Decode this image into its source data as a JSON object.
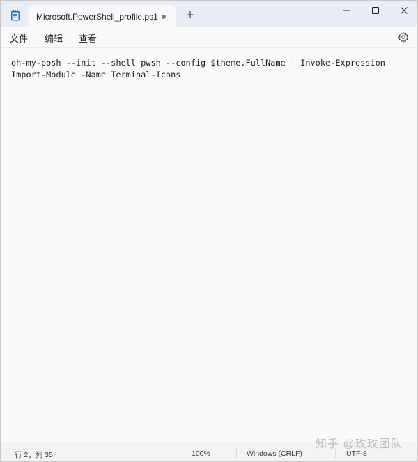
{
  "tab": {
    "title": "Microsoft.PowerShell_profile.ps1"
  },
  "icons": {
    "app": "notepad-icon",
    "unsaved": "unsaved-dot-icon",
    "new_tab": "plus-icon",
    "minimize": "minimize-icon",
    "maximize": "maximize-icon",
    "close": "close-icon",
    "settings": "gear-icon"
  },
  "menu": {
    "file": "文件",
    "edit": "编辑",
    "view": "查看"
  },
  "editor": {
    "lines": [
      "oh-my-posh --init --shell pwsh --config $theme.FullName | Invoke-Expression",
      "Import-Module -Name Terminal-Icons"
    ]
  },
  "status": {
    "position": "行 2，列 35",
    "zoom": "100%",
    "line_ending": "Windows (CRLF)",
    "encoding": "UTF-8"
  },
  "watermark": "知乎 @玫玫团队",
  "colors": {
    "titlebar_bg": "#e9eef6",
    "tab_bg": "#f9f9f9",
    "editor_bg": "#fafafa",
    "app_icon_blue": "#1f6fd1"
  }
}
